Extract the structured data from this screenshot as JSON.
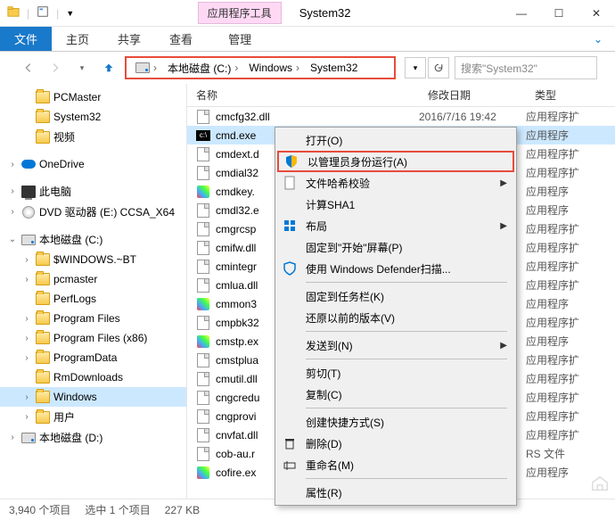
{
  "window": {
    "title": "System32",
    "tools_tab": "应用程序工具",
    "min": "—",
    "max": "☐",
    "close": "✕"
  },
  "ribbon": {
    "file": "文件",
    "tabs": [
      "主页",
      "共享",
      "查看"
    ],
    "tools": "管理"
  },
  "address": {
    "segments": [
      "本地磁盘 (C:)",
      "Windows",
      "System32"
    ],
    "search_placeholder": "搜索\"System32\""
  },
  "tree": [
    {
      "label": "PCMaster",
      "icon": "folder",
      "indent": 1
    },
    {
      "label": "System32",
      "icon": "folder",
      "indent": 1
    },
    {
      "label": "视频",
      "icon": "folder",
      "indent": 1
    },
    {
      "sep": true
    },
    {
      "label": "OneDrive",
      "icon": "cloud",
      "indent": 0,
      "expander": ">"
    },
    {
      "sep": true
    },
    {
      "label": "此电脑",
      "icon": "pc",
      "indent": 0,
      "expander": ">"
    },
    {
      "label": "DVD 驱动器 (E:) CCSA_X64",
      "icon": "disc",
      "indent": 0,
      "expander": ">"
    },
    {
      "sep": true
    },
    {
      "label": "本地磁盘 (C:)",
      "icon": "drive",
      "indent": 0,
      "expander": "v"
    },
    {
      "label": "$WINDOWS.~BT",
      "icon": "folder",
      "indent": 1,
      "expander": ">"
    },
    {
      "label": "pcmaster",
      "icon": "folder",
      "indent": 1,
      "expander": ">"
    },
    {
      "label": "PerfLogs",
      "icon": "folder",
      "indent": 1
    },
    {
      "label": "Program Files",
      "icon": "folder",
      "indent": 1,
      "expander": ">"
    },
    {
      "label": "Program Files (x86)",
      "icon": "folder",
      "indent": 1,
      "expander": ">"
    },
    {
      "label": "ProgramData",
      "icon": "folder",
      "indent": 1,
      "expander": ">"
    },
    {
      "label": "RmDownloads",
      "icon": "folder",
      "indent": 1
    },
    {
      "label": "Windows",
      "icon": "folder",
      "indent": 1,
      "expander": ">",
      "selected": true
    },
    {
      "label": "用户",
      "icon": "folder",
      "indent": 1,
      "expander": ">"
    },
    {
      "label": "本地磁盘 (D:)",
      "icon": "drive",
      "indent": 0,
      "expander": ">"
    }
  ],
  "columns": {
    "name": "名称",
    "date": "修改日期",
    "type": "类型"
  },
  "files": [
    {
      "name": "cmcfg32.dll",
      "icon": "gen",
      "date": "2016/7/16 19:42",
      "type": "应用程序扩"
    },
    {
      "name": "cmd.exe",
      "icon": "exe",
      "type": "应用程序",
      "selected": true
    },
    {
      "name": "cmdext.d",
      "icon": "gen",
      "type": "应用程序扩"
    },
    {
      "name": "cmdial32",
      "icon": "gen",
      "type": "应用程序扩"
    },
    {
      "name": "cmdkey.",
      "icon": "col",
      "type": "应用程序"
    },
    {
      "name": "cmdl32.e",
      "icon": "gen",
      "type": "应用程序"
    },
    {
      "name": "cmgrcsp",
      "icon": "gen",
      "type": "应用程序扩"
    },
    {
      "name": "cmifw.dll",
      "icon": "gen",
      "type": "应用程序扩"
    },
    {
      "name": "cmintegr",
      "icon": "gen",
      "type": "应用程序扩"
    },
    {
      "name": "cmlua.dll",
      "icon": "gen",
      "type": "应用程序扩"
    },
    {
      "name": "cmmon3",
      "icon": "col",
      "type": "应用程序"
    },
    {
      "name": "cmpbk32",
      "icon": "gen",
      "type": "应用程序扩"
    },
    {
      "name": "cmstp.ex",
      "icon": "col",
      "type": "应用程序"
    },
    {
      "name": "cmstplua",
      "icon": "gen",
      "type": "应用程序扩"
    },
    {
      "name": "cmutil.dll",
      "icon": "gen",
      "type": "应用程序扩"
    },
    {
      "name": "cngcredu",
      "icon": "gen",
      "type": "应用程序扩"
    },
    {
      "name": "cngprovi",
      "icon": "gen",
      "type": "应用程序扩"
    },
    {
      "name": "cnvfat.dll",
      "icon": "gen",
      "type": "应用程序扩"
    },
    {
      "name": "cob-au.r",
      "icon": "gen",
      "type": "RS 文件"
    },
    {
      "name": "cofire.ex",
      "icon": "col",
      "type": "应用程序"
    }
  ],
  "context_menu": [
    {
      "label": "打开(O)"
    },
    {
      "label": "以管理员身份运行(A)",
      "icon": "shield",
      "highlight": true
    },
    {
      "label": "文件哈希校验",
      "icon": "doc",
      "submenu": true
    },
    {
      "label": "计算SHA1"
    },
    {
      "label": "布局",
      "icon": "grid",
      "submenu": true
    },
    {
      "label": "固定到\"开始\"屏幕(P)"
    },
    {
      "label": "使用 Windows Defender扫描...",
      "icon": "defender"
    },
    {
      "sep": true
    },
    {
      "label": "固定到任务栏(K)"
    },
    {
      "label": "还原以前的版本(V)"
    },
    {
      "sep": true
    },
    {
      "label": "发送到(N)",
      "submenu": true
    },
    {
      "sep": true
    },
    {
      "label": "剪切(T)"
    },
    {
      "label": "复制(C)"
    },
    {
      "sep": true
    },
    {
      "label": "创建快捷方式(S)"
    },
    {
      "label": "删除(D)",
      "icon": "delete"
    },
    {
      "label": "重命名(M)",
      "icon": "rename"
    },
    {
      "sep": true
    },
    {
      "label": "属性(R)"
    }
  ],
  "status": {
    "count": "3,940 个项目",
    "selection": "选中 1 个项目",
    "size": "227 KB"
  }
}
